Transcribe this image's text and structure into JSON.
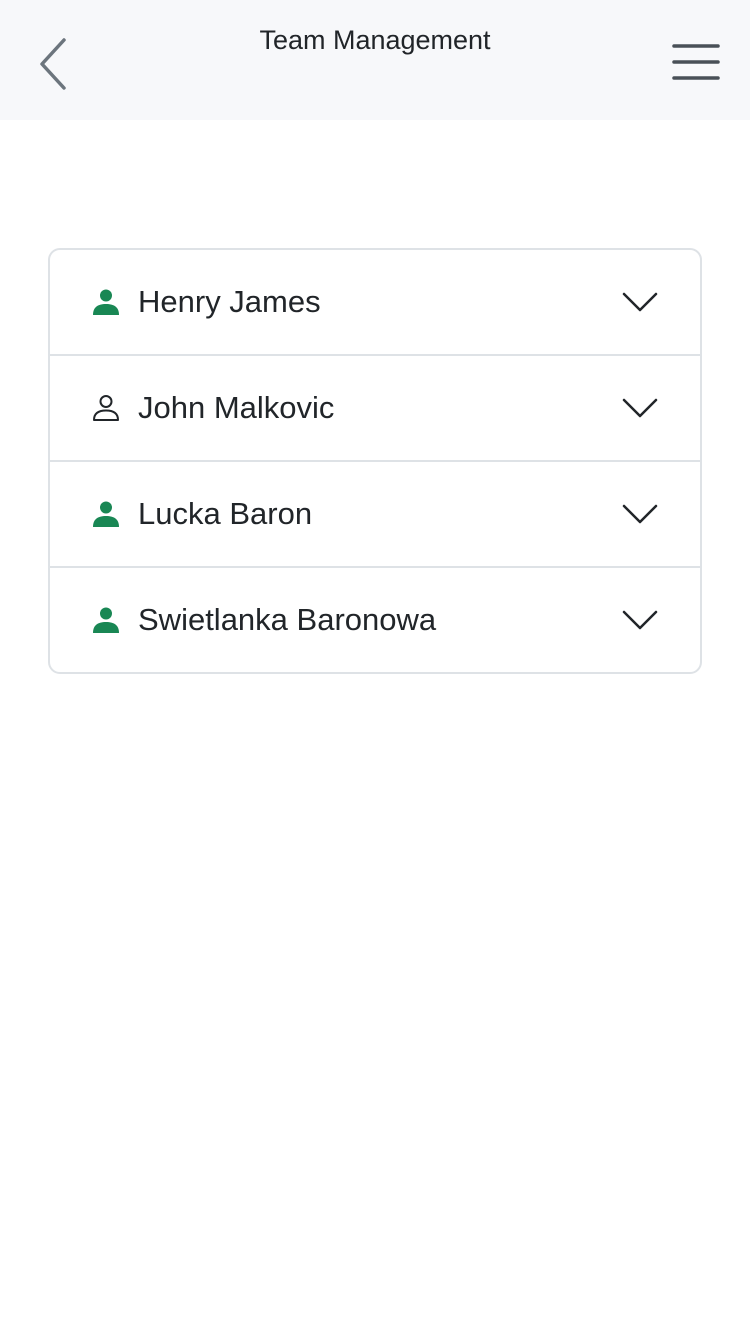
{
  "header": {
    "title": "Team Management",
    "back_icon": "chevron-left-icon",
    "menu_icon": "hamburger-menu-icon",
    "background": "#f7f8fa"
  },
  "team": {
    "accent": "#198754",
    "members": [
      {
        "name": "Henry James",
        "icon": "person-fill-icon",
        "active": true
      },
      {
        "name": "John Malkovic",
        "icon": "person-outline-icon",
        "active": false
      },
      {
        "name": "Lucka Baron",
        "icon": "person-fill-icon",
        "active": true
      },
      {
        "name": "Swietlanka Baronowa",
        "icon": "person-fill-icon",
        "active": true
      }
    ]
  }
}
